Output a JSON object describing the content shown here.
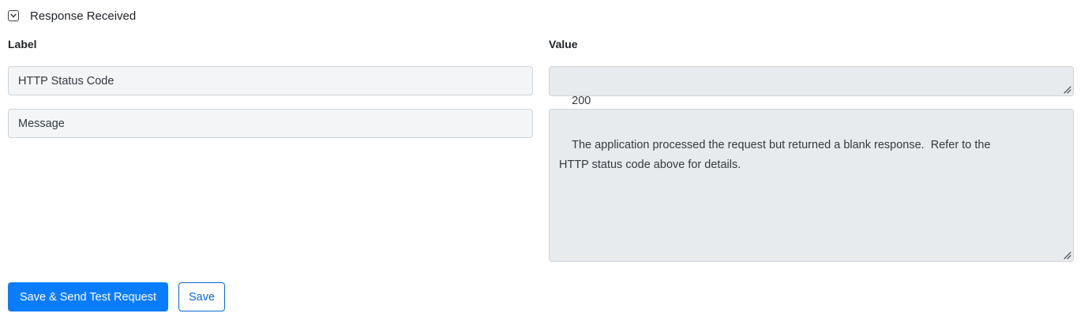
{
  "section": {
    "title": "Response Received",
    "toggle_icon": "chevron-down-icon"
  },
  "columns": {
    "label_heading": "Label",
    "value_heading": "Value"
  },
  "rows": [
    {
      "label": "HTTP Status Code",
      "value": "200"
    },
    {
      "label": "Message",
      "value": "The application processed the request but returned a blank response.  Refer to the\nHTTP status code above for details."
    }
  ],
  "actions": {
    "primary_label": "Save & Send Test Request",
    "secondary_label": "Save"
  },
  "colors": {
    "primary": "#0a7cff",
    "label_field_bg": "#f3f5f7",
    "value_field_bg": "#e8ebee",
    "border": "#cdd3da"
  }
}
